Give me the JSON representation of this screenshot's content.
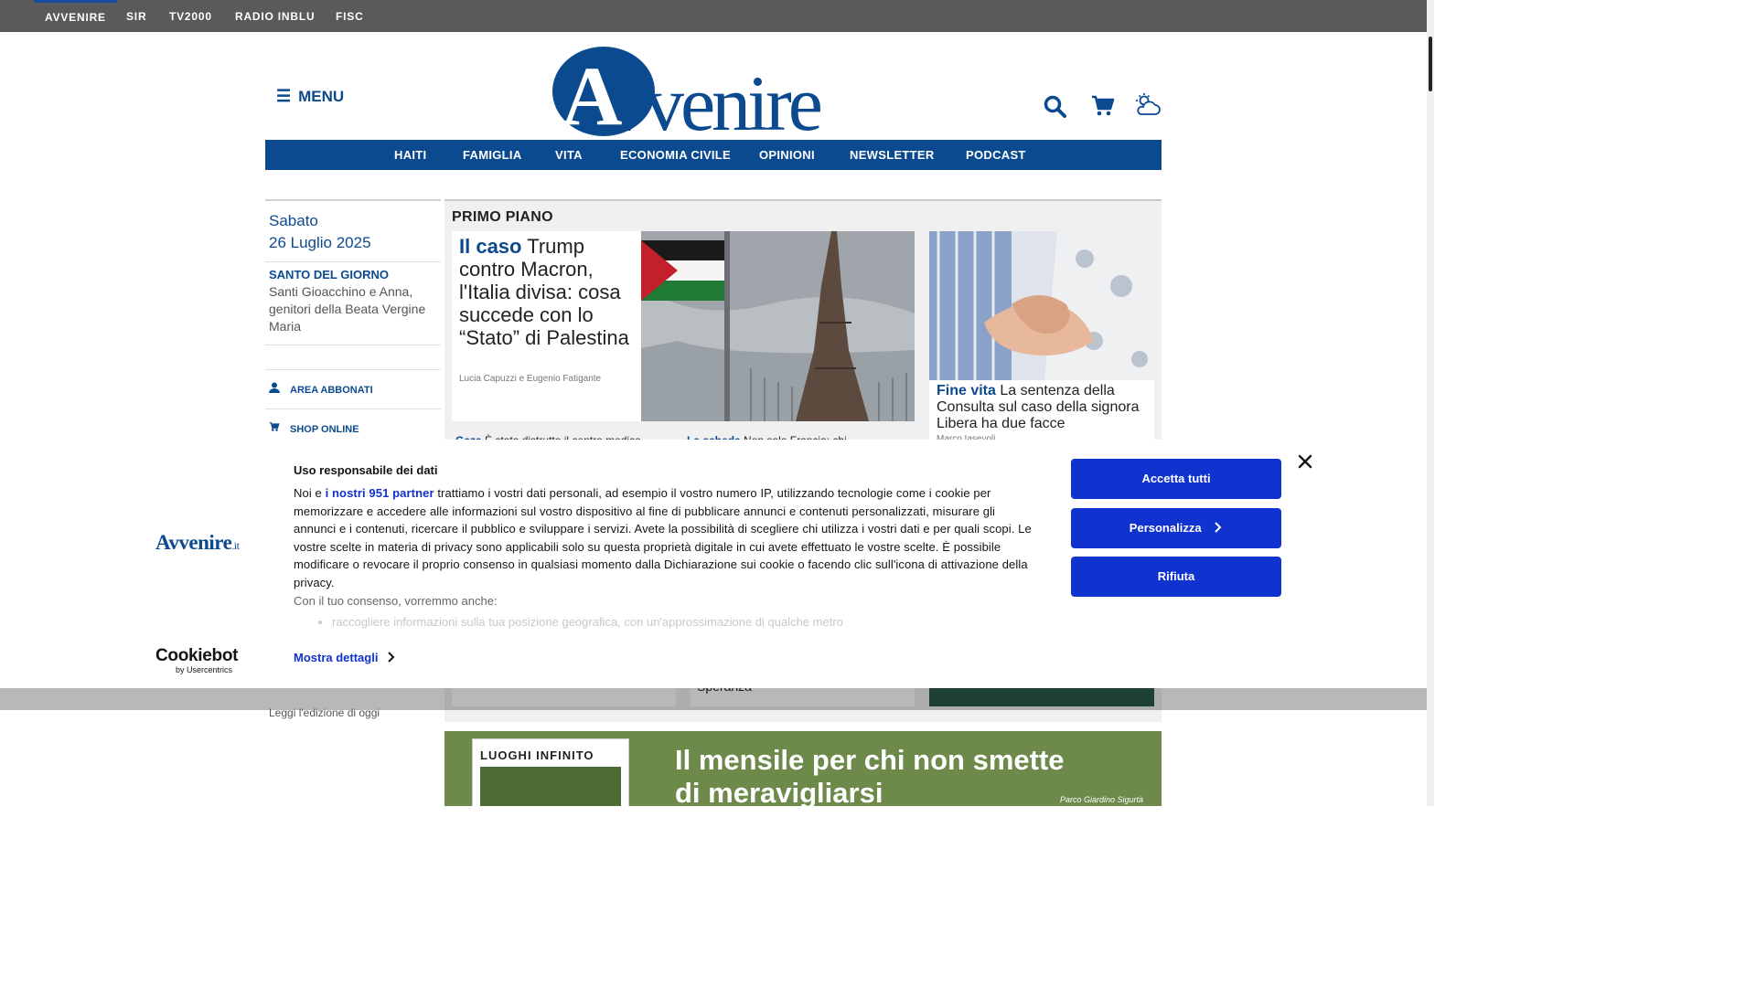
{
  "topbar": {
    "items": [
      "AVVENIRE",
      "SIR",
      "TV2000",
      "RADIO INBLU",
      "FISC"
    ]
  },
  "header": {
    "menu_label": "MENU",
    "logo_text": "Avvenire",
    "icons": [
      "search-icon",
      "cart-icon",
      "weather-icon"
    ]
  },
  "nav": {
    "items": [
      "HAITI",
      "FAMIGLIA",
      "VITA",
      "ECONOMIA CIVILE",
      "OPINIONI",
      "NEWSLETTER",
      "PODCAST"
    ]
  },
  "sidebar": {
    "day": "Sabato",
    "date": "26 Luglio 2025",
    "saint_title": "SANTO DEL GIORNO",
    "saint_text": "Santi Gioacchino e Anna, genitori della Beata Vergine Maria",
    "links": [
      "AREA ABBONATI",
      "SHOP ONLINE"
    ],
    "edition_link": "Leggi l'edizione di oggi"
  },
  "primo_piano": {
    "title": "PRIMO PIANO",
    "main_story": {
      "kicker": "Il caso",
      "headline": "Trump contro Macron, l'Italia divisa: cosa succede con lo “Stato” di Palestina",
      "author": "Lucia Capuzzi e Eugenio Fatigante"
    },
    "side_story": {
      "kicker": "Fine vita",
      "headline": "La sentenza della Consulta sul caso della signora Libera ha due facce",
      "author": "Marco Iasevoli"
    },
    "sub_stories": [
      {
        "kicker": "Gaza",
        "headline": "È stato distrutto il centro medico"
      },
      {
        "kicker": "La scheda",
        "headline": "Non solo Francia: chi"
      }
    ],
    "partial_text": "Speranza"
  },
  "banner": {
    "magazine_title": "LUOGHI INFINITO",
    "text": "Il mensile per chi non smette di meravigliarsi",
    "credit": "Parco Giardino Sigurtà"
  },
  "cookie_banner": {
    "brand_logo": "Avvenire",
    "brand_suffix": ".it",
    "title": "Uso responsabile dei dati",
    "text_before_link": "Noi e ",
    "partners_link": "i nostri 951 partner",
    "text_after_link": " trattiamo i vostri dati personali, ad esempio il vostro numero IP, utilizzando tecnologie come i cookie per memorizzare e accedere alle informazioni sul vostro dispositivo al fine di pubblicare annunci e contenuti personalizzati, misurare gli annunci e i contenuti, ricercare il pubblico e sviluppare i servizi. Avete la possibilità di scegliere chi utilizza i vostri dati e per quali scopi. Le vostre scelte in materia di privacy sono applicabili solo su questa proprietà digitale in cui avete effettuato le vostre scelte. È possibile modificare o revocare il proprio consenso in qualsiasi momento dalla Dichiarazione sui cookie o facendo clic sull'icona di attivazione della privacy.",
    "consent_heading": "Con il tuo consenso, vorremmo anche:",
    "consent_item": "raccogliere informazioni sulla tua posizione geografica, con un'approssimazione di qualche metro",
    "details_link": "Mostra dettagli",
    "buttons": {
      "accept": "Accetta tutti",
      "customize": "Personalizza",
      "reject": "Rifiuta"
    },
    "cookiebot_brand": "Cookiebot",
    "cookiebot_sub": "by Usercentrics"
  },
  "colors": {
    "brand_blue": "#0b4a8f",
    "topbar_gray": "#5a5a5a",
    "cookie_button_blue": "#1032cf"
  }
}
